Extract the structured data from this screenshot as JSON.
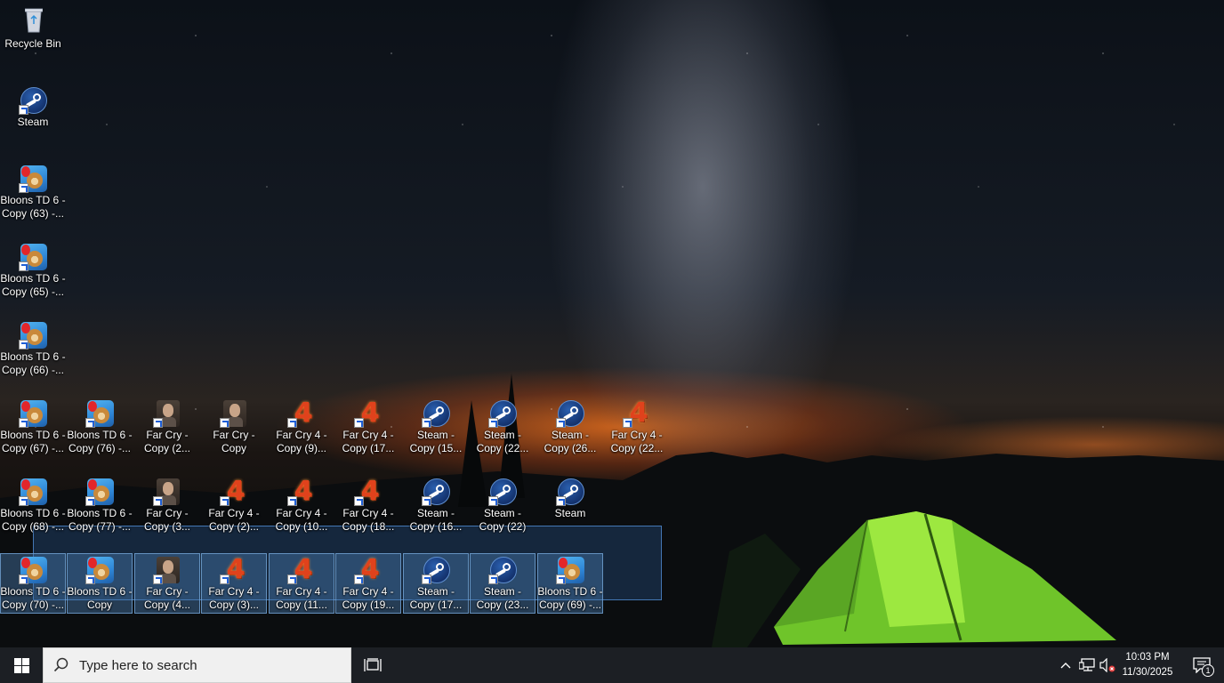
{
  "desktop": {
    "icons": [
      {
        "id": "recycle-bin",
        "type": "recycle",
        "label": "Recycle Bin",
        "selected": false
      },
      {
        "id": "steam",
        "type": "steam",
        "label": "Steam",
        "selected": false
      },
      {
        "id": "bloons-63",
        "type": "bloons",
        "label": "Bloons TD 6 -\nCopy (63) -...",
        "selected": false
      },
      {
        "id": "bloons-65",
        "type": "bloons",
        "label": "Bloons TD 6 -\nCopy (65) -...",
        "selected": false
      },
      {
        "id": "bloons-66",
        "type": "bloons",
        "label": "Bloons TD 6 -\nCopy (66) -...",
        "selected": false
      },
      {
        "id": "bloons-67",
        "type": "bloons",
        "label": "Bloons TD 6 -\nCopy (67) -...",
        "selected": false
      },
      {
        "id": "bloons-76",
        "type": "bloons",
        "label": "Bloons TD 6 -\nCopy (76) -...",
        "selected": false
      },
      {
        "id": "farcry-copy-2",
        "type": "farcry",
        "label": "Far Cry -\nCopy (2...",
        "selected": false
      },
      {
        "id": "farcry-copy",
        "type": "farcry",
        "label": "Far Cry -\nCopy",
        "selected": false
      },
      {
        "id": "farcry4-copy-9",
        "type": "farcry4",
        "label": "Far Cry 4 -\nCopy (9)...",
        "selected": false
      },
      {
        "id": "farcry4-copy-17",
        "type": "farcry4",
        "label": "Far Cry 4 -\nCopy (17...",
        "selected": false
      },
      {
        "id": "steam-copy-15",
        "type": "steam",
        "label": "Steam -\nCopy (15...",
        "selected": false
      },
      {
        "id": "steam-copy-22a",
        "type": "steam",
        "label": "Steam -\nCopy (22...",
        "selected": false
      },
      {
        "id": "steam-copy-26",
        "type": "steam",
        "label": "Steam -\nCopy (26...",
        "selected": false
      },
      {
        "id": "farcry4-copy-22",
        "type": "farcry4",
        "label": "Far Cry 4 -\nCopy (22...",
        "selected": false
      },
      {
        "id": "bloons-68",
        "type": "bloons",
        "label": "Bloons TD 6 -\nCopy (68) -...",
        "selected": false
      },
      {
        "id": "bloons-77",
        "type": "bloons",
        "label": "Bloons TD 6 -\nCopy (77) -...",
        "selected": false
      },
      {
        "id": "farcry-copy-3",
        "type": "farcry",
        "label": "Far Cry -\nCopy (3...",
        "selected": false
      },
      {
        "id": "farcry4-copy-2",
        "type": "farcry4",
        "label": "Far Cry 4 -\nCopy (2)...",
        "selected": false
      },
      {
        "id": "farcry4-copy-10",
        "type": "farcry4",
        "label": "Far Cry 4 -\nCopy (10...",
        "selected": false
      },
      {
        "id": "farcry4-copy-18",
        "type": "farcry4",
        "label": "Far Cry 4 -\nCopy (18...",
        "selected": false
      },
      {
        "id": "steam-copy-16",
        "type": "steam",
        "label": "Steam -\nCopy (16...",
        "selected": false
      },
      {
        "id": "steam-copy-22b",
        "type": "steam",
        "label": "Steam -\nCopy (22)",
        "selected": false
      },
      {
        "id": "steam-2",
        "type": "steam",
        "label": "Steam",
        "selected": false
      },
      {
        "id": "bloons-70",
        "type": "bloons",
        "label": "Bloons TD 6 -\nCopy (70) -...",
        "selected": true
      },
      {
        "id": "bloons-copy",
        "type": "bloons",
        "label": "Bloons TD 6 -\nCopy",
        "selected": true
      },
      {
        "id": "farcry-copy-4",
        "type": "farcry",
        "label": "Far Cry -\nCopy (4...",
        "selected": true
      },
      {
        "id": "farcry4-copy-3",
        "type": "farcry4",
        "label": "Far Cry 4 -\nCopy (3)...",
        "selected": true
      },
      {
        "id": "farcry4-copy-11",
        "type": "farcry4",
        "label": "Far Cry 4 -\nCopy (11...",
        "selected": true
      },
      {
        "id": "farcry4-copy-19",
        "type": "farcry4",
        "label": "Far Cry 4 -\nCopy (19...",
        "selected": true
      },
      {
        "id": "steam-copy-17",
        "type": "steam",
        "label": "Steam -\nCopy (17...",
        "selected": true
      },
      {
        "id": "steam-copy-23",
        "type": "steam",
        "label": "Steam -\nCopy (23...",
        "selected": true
      },
      {
        "id": "bloons-69",
        "type": "bloons",
        "label": "Bloons TD 6 -\nCopy (69) -...",
        "selected": true
      }
    ]
  },
  "taskbar": {
    "search_placeholder": "Type here to search",
    "clock": {
      "time": "10:03 PM",
      "date": "11/30/2025"
    },
    "notification_count": "1",
    "tray_icons": [
      "chevron-up-icon",
      "network-icon",
      "volume-muted-icon"
    ]
  },
  "colors": {
    "taskbar_bg": "#1c1f24",
    "selection_fill": "#285a96",
    "tent_green": "#7cd42a"
  }
}
